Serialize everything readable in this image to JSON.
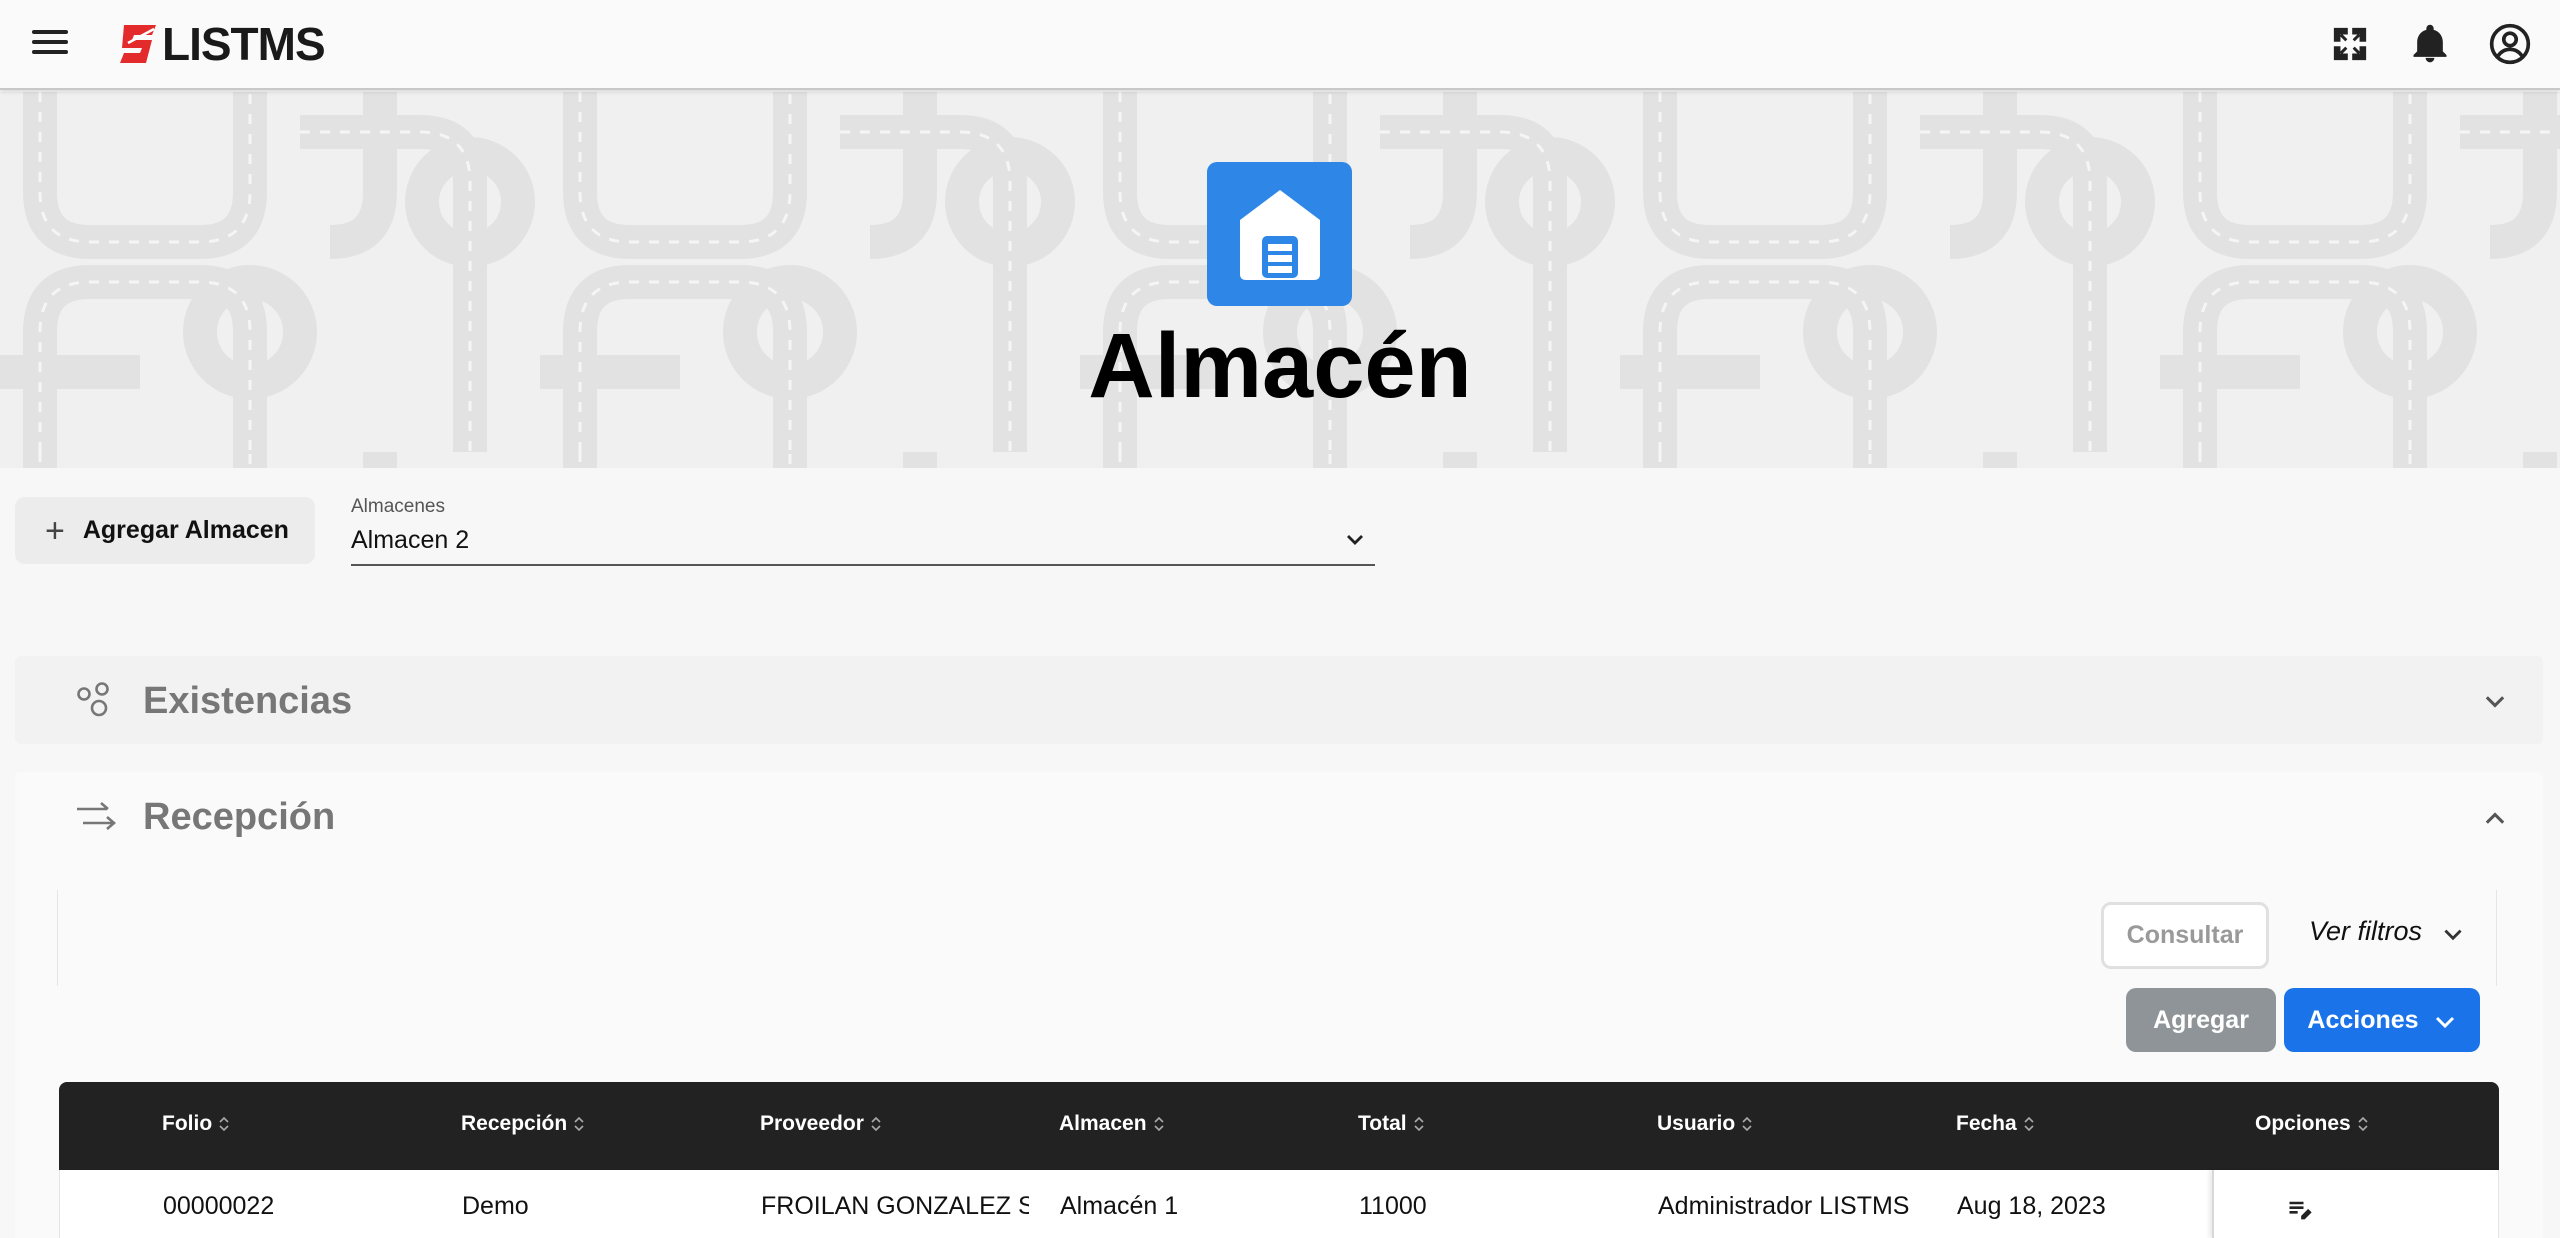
{
  "app": {
    "brand": "LISTMS"
  },
  "hero": {
    "title": "Almacén",
    "icon": "warehouse-icon"
  },
  "controls": {
    "add_button": "Agregar Almacen",
    "select_label": "Almacenes",
    "select_value": "Almacen 2"
  },
  "sections": {
    "existencias": {
      "title": "Existencias",
      "icon": "molecule-icon"
    },
    "recepcion": {
      "title": "Recepción",
      "icon": "transfer-arrows-icon"
    }
  },
  "filters": {
    "consultar": "Consultar",
    "ver_filtros": "Ver filtros"
  },
  "actions": {
    "agregar": "Agregar",
    "acciones": "Acciones"
  },
  "table": {
    "columns": [
      "Folio",
      "Recepción",
      "Proveedor",
      "Almacen",
      "Total",
      "Usuario",
      "Fecha",
      "Opciones"
    ],
    "rows": [
      {
        "folio": "00000022",
        "recepcion": "Demo",
        "proveedor": "FROILAN GONZALEZ SOSA",
        "almacen": "Almacén 1",
        "total": "11000",
        "usuario": "Administrador LISTMS",
        "fecha": "Aug 18, 2023"
      }
    ]
  },
  "colors": {
    "accent": "#1a73e8",
    "hero_icon_bg": "#2e86e6",
    "header_dark": "#222222",
    "brand_red": "#e32b2b"
  }
}
